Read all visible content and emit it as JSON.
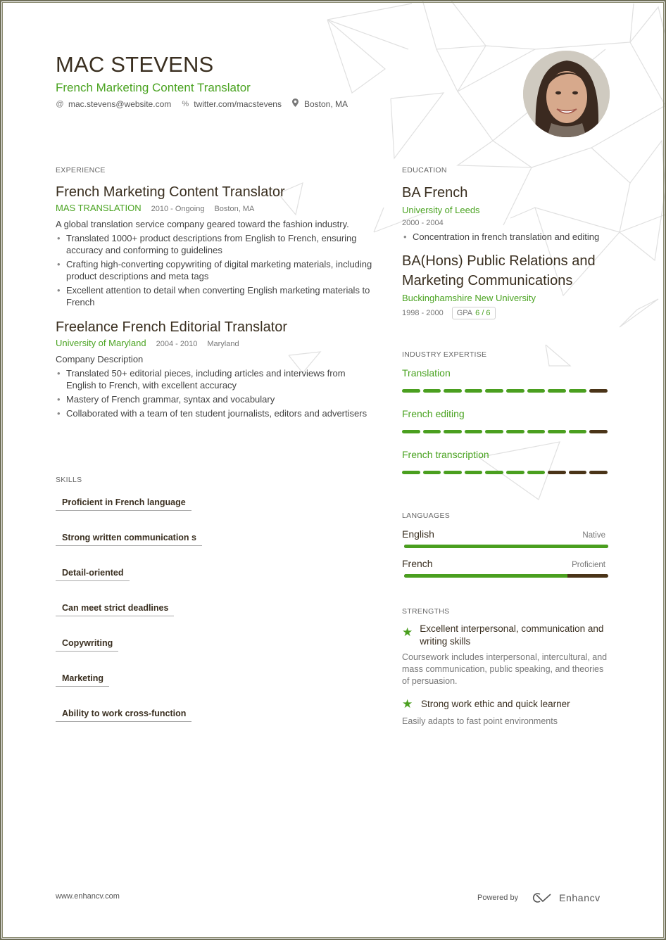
{
  "header": {
    "name": "MAC STEVENS",
    "headline": "French Marketing Content Translator",
    "contacts": [
      {
        "icon": "at-icon",
        "glyph": "@",
        "text": "mac.stevens@website.com"
      },
      {
        "icon": "link-icon",
        "glyph": "%",
        "text": "twitter.com/macstevens"
      },
      {
        "icon": "location-pin-icon",
        "glyph": "⚲",
        "text": "Boston, MA"
      }
    ]
  },
  "experience": {
    "title": "EXPERIENCE",
    "jobs": [
      {
        "title": "French Marketing Content Translator",
        "company": "MAS TRANSLATION",
        "dates": "2010 - Ongoing",
        "location": "Boston, MA",
        "description": "A global translation service company geared toward the fashion industry.",
        "bullets": [
          "Translated 1000+ product descriptions from English to French, ensuring accuracy and conforming to guidelines",
          "Crafting high-converting copywriting of digital marketing materials, including product descriptions and meta tags",
          "Excellent attention to detail when converting English marketing materials to French"
        ]
      },
      {
        "title": "Freelance French Editorial Translator",
        "company": "University of Maryland",
        "dates": "2004 - 2010",
        "location": "Maryland",
        "description": "Company Description",
        "bullets": [
          "Translated 50+ editorial pieces, including articles and interviews from English to French, with excellent accuracy",
          "Mastery of French grammar, syntax and vocabulary",
          "Collaborated with a team of ten student journalists, editors and advertisers"
        ]
      }
    ]
  },
  "skills": {
    "title": "SKILLS",
    "items": [
      "Proficient in French language",
      "Strong written communication s",
      "Detail-oriented",
      "Can meet strict deadlines",
      "Copywriting",
      "Marketing",
      "Ability to work cross-function"
    ]
  },
  "education": {
    "title": "EDUCATION",
    "entries": [
      {
        "degree": "BA French",
        "school": "University of Leeds",
        "dates": "2000 - 2004",
        "bullets": [
          "Concentration in french translation and editing"
        ]
      },
      {
        "degree": "BA(Hons) Public Relations and Marketing Communications",
        "school": "Buckinghamshire New University",
        "dates": "1998 - 2000",
        "gpa_label": "GPA",
        "gpa_value": "6 / 6"
      }
    ]
  },
  "expertise": {
    "title": "INDUSTRY EXPERTISE",
    "max": 10,
    "items": [
      {
        "label": "Translation",
        "level": 9
      },
      {
        "label": "French editing",
        "level": 9
      },
      {
        "label": "French transcription",
        "level": 7
      }
    ]
  },
  "languages": {
    "title": "LANGUAGES",
    "items": [
      {
        "name": "English",
        "level_label": "Native",
        "proficiency_percent": 100
      },
      {
        "name": "French",
        "level_label": "Proficient",
        "proficiency_percent": 80
      }
    ]
  },
  "strengths": {
    "title": "STRENGTHS",
    "items": [
      {
        "icon": "star-icon",
        "title": "Excellent interpersonal, communication and writing skills",
        "description": "Coursework includes interpersonal, intercultural, and mass communication, public speaking, and theories of persuasion."
      },
      {
        "icon": "star-icon",
        "title": "Strong work ethic and quick learner",
        "description": "Easily adapts to fast point environments"
      }
    ]
  },
  "footer": {
    "url": "www.enhancv.com",
    "powered_by": "Powered by",
    "brand": "Enhancv"
  },
  "colors": {
    "accent_green": "#4a9f1f",
    "dark_brown": "#4a3418",
    "heading": "#3a2f20"
  }
}
